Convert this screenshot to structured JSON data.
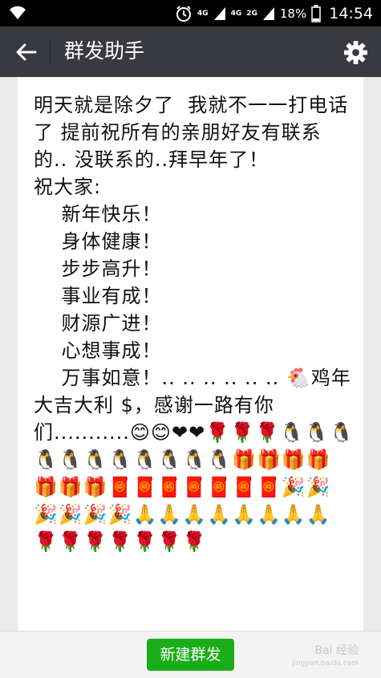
{
  "status_bar": {
    "network_4g": "4G",
    "network_4g_2": "4G",
    "network_2g": "2G",
    "battery": "18%",
    "time": "14:54"
  },
  "header": {
    "title": "群发助手"
  },
  "message": {
    "text": "明天就是除夕了  我就不一一打电话了 提前祝所有的亲朋好友有联系的.. 没联系的..拜早年了！\n祝大家:\n    新年快乐！\n    身体健康！\n    步步高升！\n    事业有成！\n    财源广进！\n    心想事成！\n    万事如意！.. .. .. .. .. .. 🐔鸡年大吉大利 $，感谢一路有你们...........😊😊❤❤🌹🌹🌹🐧🐧🐧🐧🐧🐧🐧🐧🐧🐧🐧🎁🎁🎁🎁🎁🎁🎁🧧🧧🧧🧧🧧🧧🧧🎉🎉🎉🎉🎉🎉🙏🙏🙏🙏🙏🙏🙏🙏🌹🌹🌹🌹🌹🌹🌹"
  },
  "footer": {
    "send_label": "新建群发"
  },
  "watermark": {
    "brand": "Bai 经验",
    "url": "jingyan.baidu.com"
  }
}
